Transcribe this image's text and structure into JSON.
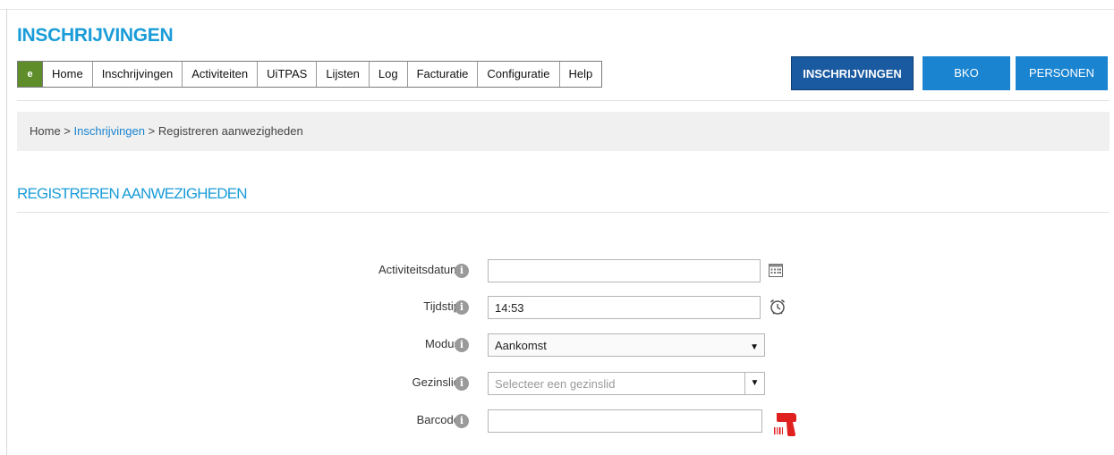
{
  "app": {
    "title": "INSCHRIJVINGEN"
  },
  "menu": {
    "logo_text": "e",
    "items": [
      "Home",
      "Inschrijvingen",
      "Activiteiten",
      "UiTPAS",
      "Lijsten",
      "Log",
      "Facturatie",
      "Configuratie",
      "Help"
    ]
  },
  "top_buttons": {
    "inschrijvingen": "INSCHRIJVINGEN",
    "bko": "BKO",
    "personen": "PERSONEN"
  },
  "breadcrumb": {
    "home": "Home",
    "sep1": " > ",
    "inschrijvingen": "Inschrijvingen",
    "sep2": " > ",
    "current": "Registreren aanwezigheden"
  },
  "page": {
    "title": "REGISTREREN AANWEZIGHEDEN"
  },
  "form": {
    "activiteitsdatum": {
      "label": "Activiteitsdatum",
      "value": ""
    },
    "tijdstip": {
      "label": "Tijdstip",
      "value": "14:53"
    },
    "modus": {
      "label": "Modus",
      "value": "Aankomst"
    },
    "gezinslid": {
      "label": "Gezinslid",
      "placeholder": "Selecteer een gezinslid"
    },
    "barcode": {
      "label": "Barcode",
      "value": ""
    },
    "info_glyph": "i"
  },
  "colors": {
    "accent": "#1a9cd8",
    "primary_button": "#1a5aa0",
    "secondary_button": "#1a84d0",
    "scanner": "#e0201f"
  }
}
